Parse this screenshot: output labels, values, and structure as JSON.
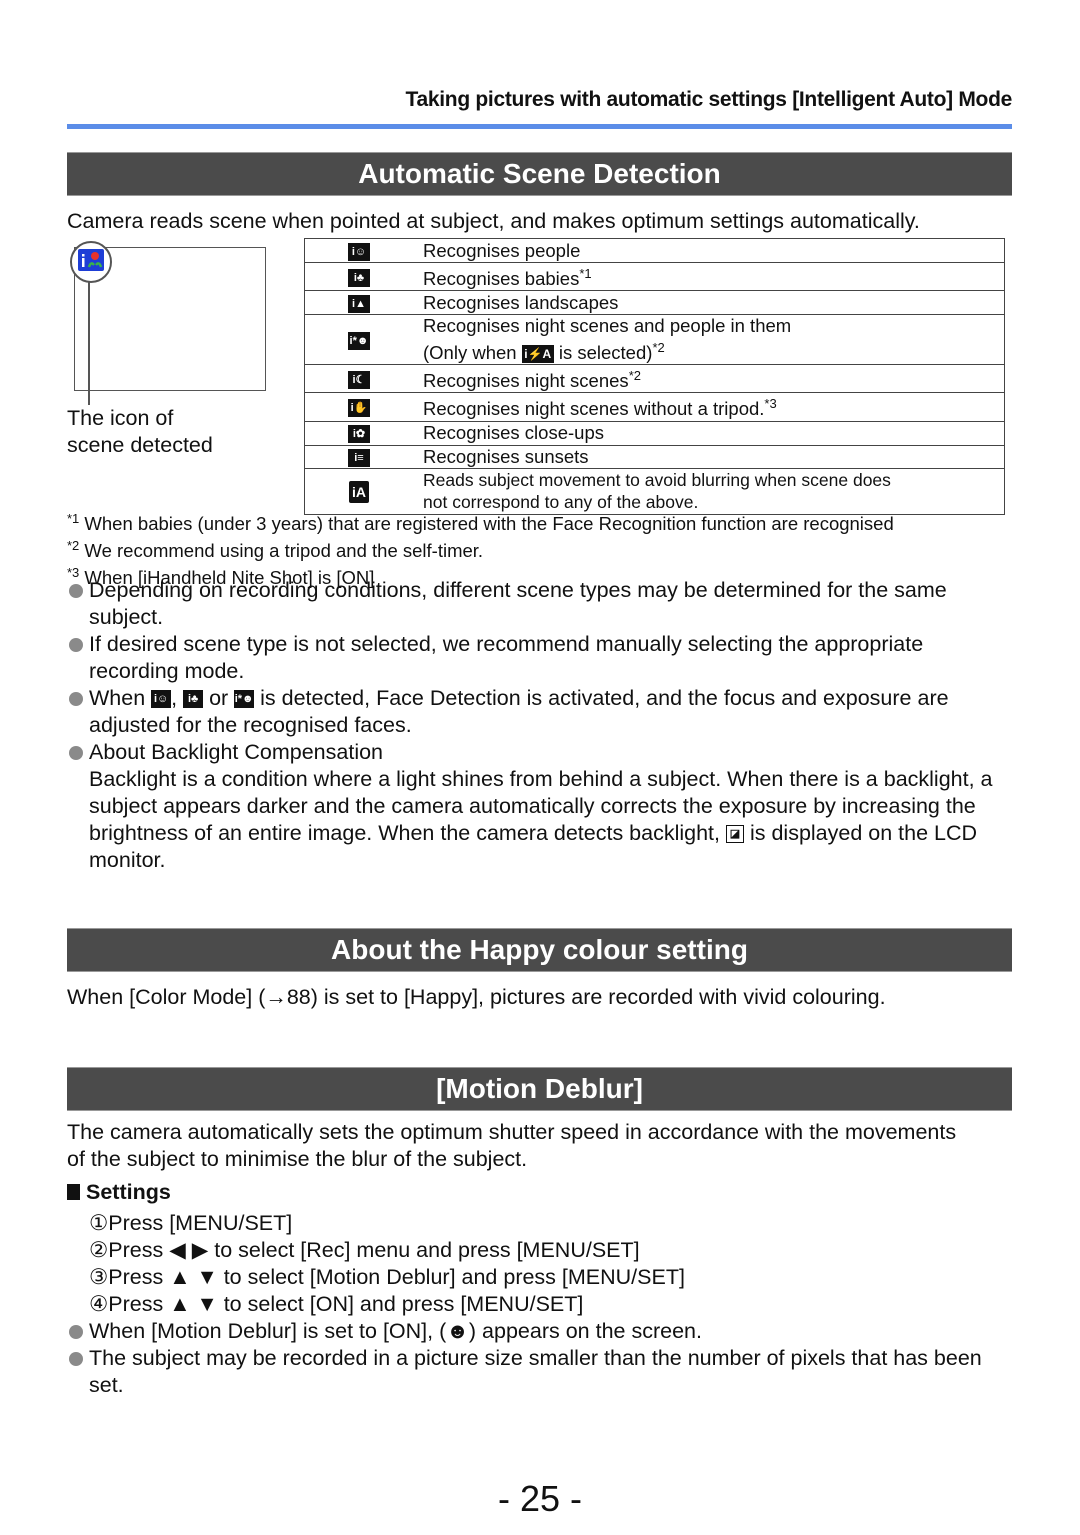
{
  "running_header": "Taking pictures with automatic settings  [Intelligent Auto] Mode",
  "colors": {
    "accent_rule": "#5b8de8",
    "section_bar": "#4b4b4b",
    "bullet": "#8a8a8a",
    "lcd_icon": "#1e3ed6"
  },
  "scene_detection": {
    "title": "Automatic Scene Detection",
    "intro": "Camera reads scene when pointed at subject, and makes optimum settings automatically.",
    "lcd_caption_line1": "The icon of",
    "lcd_caption_line2": "scene detected",
    "rows": [
      {
        "icon": "scene-people-icon",
        "glyph": "i☺",
        "text": "Recognises people",
        "sup": ""
      },
      {
        "icon": "scene-baby-icon",
        "glyph": "i♣",
        "text": "Recognises babies",
        "sup": "*1"
      },
      {
        "icon": "scene-landscape-icon",
        "glyph": "i▲",
        "text": "Recognises landscapes",
        "sup": ""
      },
      {
        "icon": "scene-night-portrait-icon",
        "glyph": "i*☻",
        "text": "Recognises night scenes and people in them",
        "line2_pre": "(Only when ",
        "line2_icon": "i⚡A",
        "line2_post": " is selected)",
        "sup": "*2"
      },
      {
        "icon": "scene-night-icon",
        "glyph": "i☾",
        "text": "Recognises night scenes",
        "sup": "*2"
      },
      {
        "icon": "scene-handheld-night-icon",
        "glyph": "i✋",
        "text": "Recognises night scenes without a tripod.",
        "sup": "*3"
      },
      {
        "icon": "scene-closeup-icon",
        "glyph": "i✿",
        "text": "Recognises close-ups",
        "sup": ""
      },
      {
        "icon": "scene-sunset-icon",
        "glyph": "i≡",
        "text": "Recognises sunsets",
        "sup": ""
      },
      {
        "icon": "intelligent-auto-icon",
        "glyph": "iA",
        "text": "Reads subject movement to avoid blurring when scene does",
        "line2": "not correspond to any of the above.",
        "sup": ""
      }
    ],
    "footnotes": [
      {
        "mark": "*1",
        "text": " When babies (under 3 years) that are registered with the Face Recognition function are recognised"
      },
      {
        "mark": "*2",
        "text": " We recommend using a tripod and the self-timer."
      },
      {
        "mark": "*3",
        "text": " When [iHandheld Nite Shot] is [ON]"
      }
    ],
    "bullets": {
      "b1": "Depending on recording conditions, different scene types may be determined for the same subject.",
      "b2": "If desired scene type is not selected, we recommend manually selecting the appropriate recording mode.",
      "b3_pre": "When ",
      "b3_sep1": ", ",
      "b3_sep2": " or ",
      "b3_post": " is detected, Face Detection is activated, and the focus and exposure are adjusted for the recognised faces.",
      "b4_title": "About Backlight Compensation",
      "b4_text": "Backlight is a condition where a light shines from behind a subject. When there is a backlight, a subject appears darker and the camera automatically corrects the exposure by increasing the brightness of an entire image. When the camera detects backlight, ",
      "b4_text_post": " is displayed on the LCD monitor."
    }
  },
  "happy_colour": {
    "title": "About the Happy colour setting",
    "text": "When [Color Mode] (→88) is set to [Happy], pictures are recorded with vivid colouring."
  },
  "motion_deblur": {
    "title": "[Motion Deblur]",
    "intro": "The camera automatically sets the optimum shutter speed in accordance with the movements of the subject to minimise the blur of the subject.",
    "settings_heading": "Settings",
    "steps": [
      "①Press [MENU/SET]",
      "②Press ◀ ▶ to select [Rec] menu and press [MENU/SET]",
      "③Press ▲ ▼ to select [Motion Deblur] and press [MENU/SET]",
      "④Press ▲ ▼ to select [ON] and press [MENU/SET]"
    ],
    "bullet1_pre": "When [Motion Deblur] is set to [ON], ",
    "bullet1_icon": "(☻)",
    "bullet1_post": " appears on the screen.",
    "bullet2": "The subject may be recorded in a picture size smaller than the number of pixels that has been set."
  },
  "page_number": "- 25 -"
}
